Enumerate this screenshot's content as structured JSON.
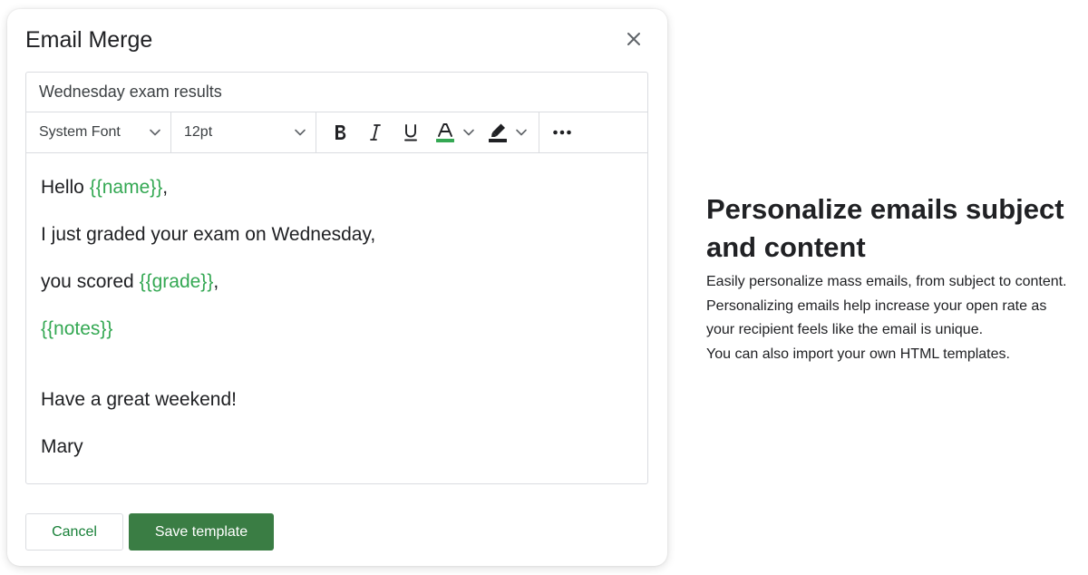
{
  "dialog": {
    "title": "Email Merge",
    "close_icon": "close-icon"
  },
  "editor": {
    "subject_value": "Wednesday exam results",
    "toolbar": {
      "font": "System Font",
      "size": "12pt",
      "icons": [
        "bold-icon",
        "italic-icon",
        "underline-icon",
        "text-color-icon",
        "highlight-icon",
        "more-icon"
      ],
      "text_color_swatch": "#34a853",
      "highlight_swatch": "#202124"
    },
    "body": {
      "greeting": "Hello ",
      "name_var": "{{name}}",
      "greeting_end": ",",
      "line2": "I just graded your exam on Wednesday,",
      "line3_prefix": "you scored ",
      "grade_var": "{{grade}}",
      "line3_end": ",",
      "notes_var": "{{notes}}",
      "line5": "Have a great weekend!",
      "signature": "Mary"
    },
    "variable_color": "#34a853"
  },
  "actions": {
    "cancel_label": "Cancel",
    "save_label": "Save template",
    "save_color": "#3a7d44"
  },
  "promo": {
    "title": "Personalize emails subject and content",
    "p1": "Easily personalize mass emails, from subject to content.",
    "p2": "Personalizing emails help increase your open rate as your recipient feels like the email is unique.",
    "p3": "You can also import your own HTML templates."
  }
}
